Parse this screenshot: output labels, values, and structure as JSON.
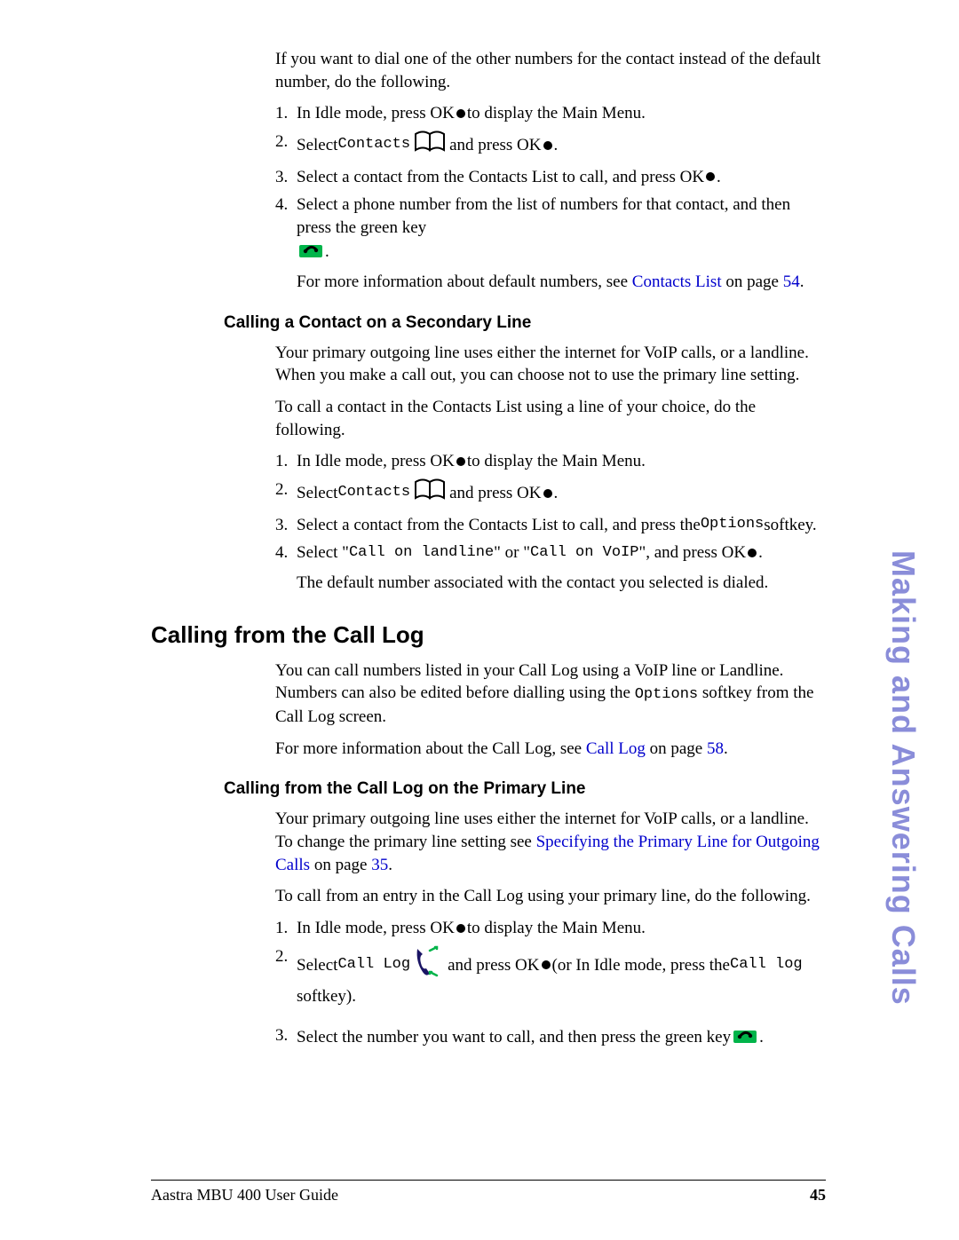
{
  "side_tab": "Making and Answering Calls",
  "intro": "If you want to dial one of the other numbers for the contact instead of the default number, do the following.",
  "step1a_pre": "In Idle mode, press OK ",
  "step1a_post": " to display the Main Menu.",
  "step2a_pre": "Select ",
  "step2a_mono": "Contacts",
  "step2a_mid": " and press OK ",
  "step3a_pre": "Select a contact from the Contacts List to call, and press OK ",
  "step4a": "Select a phone number from the list of numbers for that contact, and then press the green key ",
  "more_info_a_pre": "For more information about default numbers, see ",
  "link_contacts": "Contacts List",
  "more_info_a_mid": " on page ",
  "page_54": "54",
  "h3_secondary": "Calling a Contact on a Secondary Line",
  "secondary_p1": "Your primary outgoing line uses either the internet for VoIP calls, or a landline. When you make a call out, you can choose not to use the primary line setting.",
  "secondary_p2": "To call a contact in the Contacts List using a line of your choice, do the following.",
  "step1b_pre": "In Idle mode, press OK ",
  "step1b_post": " to display the Main Menu.",
  "step2b_pre": "Select ",
  "step2b_mono": "Contacts",
  "step2b_mid": " and press OK ",
  "step3b_pre": "Select a contact from the Contacts List to call, and press the ",
  "step3b_mono": "Options",
  "step3b_post": " softkey.",
  "step4b_pre": "Select \"",
  "step4b_mono1": "Call on landline",
  "step4b_mid1": "\" or \"",
  "step4b_mono2": "Call on VoIP",
  "step4b_mid2": "\", and press OK ",
  "step4b_result": "The default number associated with the contact you selected is dialed.",
  "h2_calllog": "Calling from the Call Log",
  "calllog_p1_pre": "You can call numbers listed in your Call Log using a VoIP line or Landline. Numbers can also be edited before dialling using the ",
  "calllog_p1_mono": "Options",
  "calllog_p1_post": " softkey from the Call Log screen.",
  "calllog_p2_pre": "For more information about the Call Log, see ",
  "link_calllog": "Call Log",
  "calllog_p2_mid": " on page ",
  "page_58": "58",
  "h3_calllog_primary": "Calling from the Call Log on the Primary Line",
  "cprim_p1_pre": "Your primary outgoing line uses either the internet for VoIP calls, or a landline. To change the primary line setting see ",
  "link_specifying": "Specifying the Primary Line for Outgoing Calls",
  "cprim_p1_mid": " on page ",
  "page_35": "35",
  "cprim_p2": "To call from an entry in the Call Log using your primary line, do the following.",
  "step1c_pre": "In Idle mode, press OK ",
  "step1c_post": " to display the Main Menu.",
  "step2c_pre": "Select ",
  "step2c_mono": "Call Log",
  "step2c_mid": " and press OK ",
  "step2c_post_pre": " (or In Idle mode, press the ",
  "step2c_post_mono": "Call log",
  "step2c_post_post": " softkey).",
  "step3c": "Select the number you want to call, and then press the green key ",
  "footer_left": "Aastra MBU 400 User Guide",
  "footer_right": "45",
  "num1": "1.",
  "num2": "2.",
  "num3": "3.",
  "num4": "4.",
  "period": "."
}
